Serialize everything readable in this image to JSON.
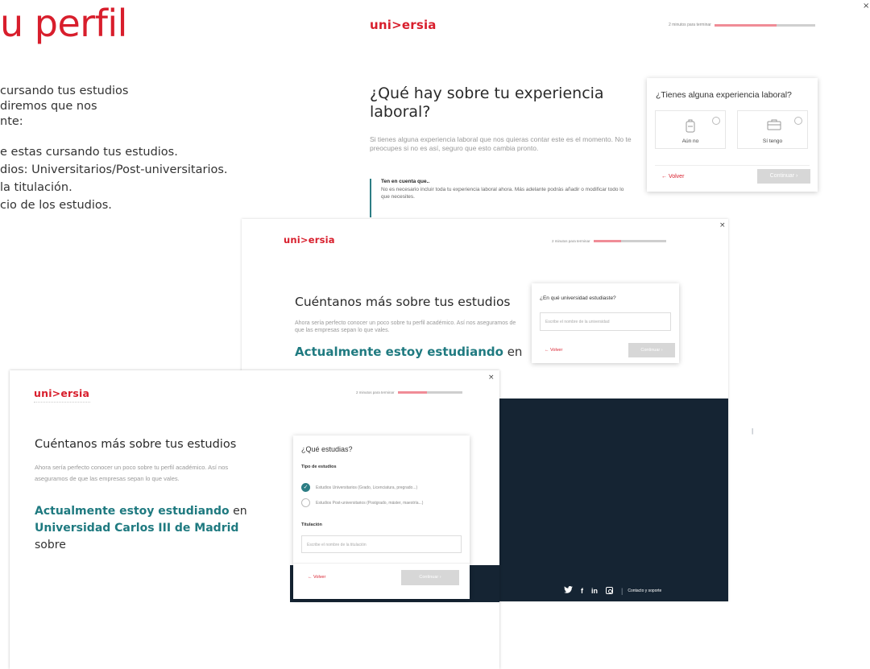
{
  "background": {
    "title": "u perfil",
    "lines": [
      "cursando tus estudios",
      "diremos que nos",
      "nte:",
      "e estas cursando tus estudios.",
      "dios: Universitarios/Post-universitarios.",
      "la titulación.",
      "cio de los estudios."
    ]
  },
  "brand": {
    "logo": "uni>ersia",
    "accent": "#d81e2c",
    "teal": "#1f7a80",
    "footer_bg": "#152433"
  },
  "panel_experience": {
    "progress_label": "2 minutos para terminar",
    "progress": 0.62,
    "close": "×",
    "title": "¿Qué hay sobre tu experiencia laboral?",
    "description": "Si tienes alguna experiencia laboral que nos quieras contar este es el momento. No te preocupes si no es así, seguro que esto cambia pronto.",
    "note_title": "Ten en cuenta que..",
    "note_text": "No es necesario incluir toda tu experiencia laboral ahora. Más adelante podrás añadir o modificar todo lo que necesites.",
    "card": {
      "question": "¿Tienes alguna experiencia laboral?",
      "option_no": "Aún no",
      "option_yes": "Sí tengo",
      "back": "Volver",
      "continue": "Continuar"
    }
  },
  "panel_university": {
    "progress_label": "2 minutos para terminar",
    "progress": 0.38,
    "close": "×",
    "title": "Cuéntanos más sobre tus estudios",
    "description": "Ahora sería perfecto conocer un poco sobre tu perfil académico. Así nos aseguramos de que las empresas sepan lo que vales.",
    "studying_highlight": "Actualmente estoy estudiando",
    "studying_rest": "en",
    "card": {
      "question": "¿En qué universidad estudiaste?",
      "placeholder": "Escribe el nombre de la universidad",
      "back": "Volver",
      "continue": "Continuar"
    },
    "footer": {
      "contact": "Contacto y soporte"
    }
  },
  "panel_studies": {
    "progress_label": "2 minutos para terminar",
    "progress": 0.45,
    "close": "×",
    "title": "Cuéntanos más sobre tus estudios",
    "description": "Ahora sería perfecto conocer un poco sobre tu perfil académico. Así nos aseguramos de que las empresas sepan lo que vales.",
    "studying_highlight": "Actualmente estoy estudiando",
    "studying_en": "en",
    "university": "Universidad Carlos III de Madrid",
    "studying_rest": "sobre",
    "card": {
      "question": "¿Qué estudias?",
      "type_label": "Tipo de estudios",
      "option_university": "Estudios Universitarios (Grado, Licenciatura, pregrado...)",
      "option_post": "Estudios Post-universitarios (Postgrado, máster, maestría...)",
      "degree_label": "Titulación",
      "degree_placeholder": "Escribe el nombre de la titulación",
      "back": "Volver",
      "continue": "Continuar"
    },
    "footer": {
      "twitter": "twitter-icon",
      "facebook": "facebook-icon",
      "linkedin": "linkedin-icon",
      "instagram": "instagram-icon",
      "contact": "Contacto y soporte"
    }
  }
}
